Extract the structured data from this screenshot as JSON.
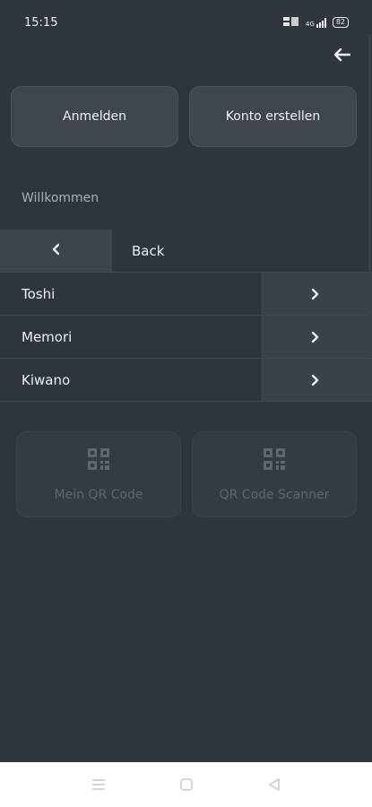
{
  "status_bar": {
    "time": "15:15",
    "battery": "82",
    "net_label": "4G"
  },
  "header": {
    "back_icon": "arrow-left-icon"
  },
  "auth": {
    "login_label": "Anmelden",
    "register_label": "Konto erstellen"
  },
  "welcome_text": "Willkommen",
  "back_row": {
    "label": "Back",
    "icon": "chevron-left-icon"
  },
  "list": {
    "items": [
      {
        "label": "Toshi",
        "icon": "chevron-right-icon"
      },
      {
        "label": "Memori",
        "icon": "chevron-right-icon"
      },
      {
        "label": "Kiwano",
        "icon": "chevron-right-icon"
      }
    ]
  },
  "tiles": {
    "my_qr": {
      "label": "Mein QR Code",
      "icon": "qr-code-icon"
    },
    "scanner": {
      "label": "QR Code Scanner",
      "icon": "qr-code-icon"
    }
  },
  "nav": {
    "menu_icon": "menu-icon",
    "home_icon": "home-square-icon",
    "back_icon": "triangle-back-icon"
  },
  "colors": {
    "background": "#2f353d",
    "button": "#40464e",
    "tile_disabled_text": "#5f666e"
  }
}
